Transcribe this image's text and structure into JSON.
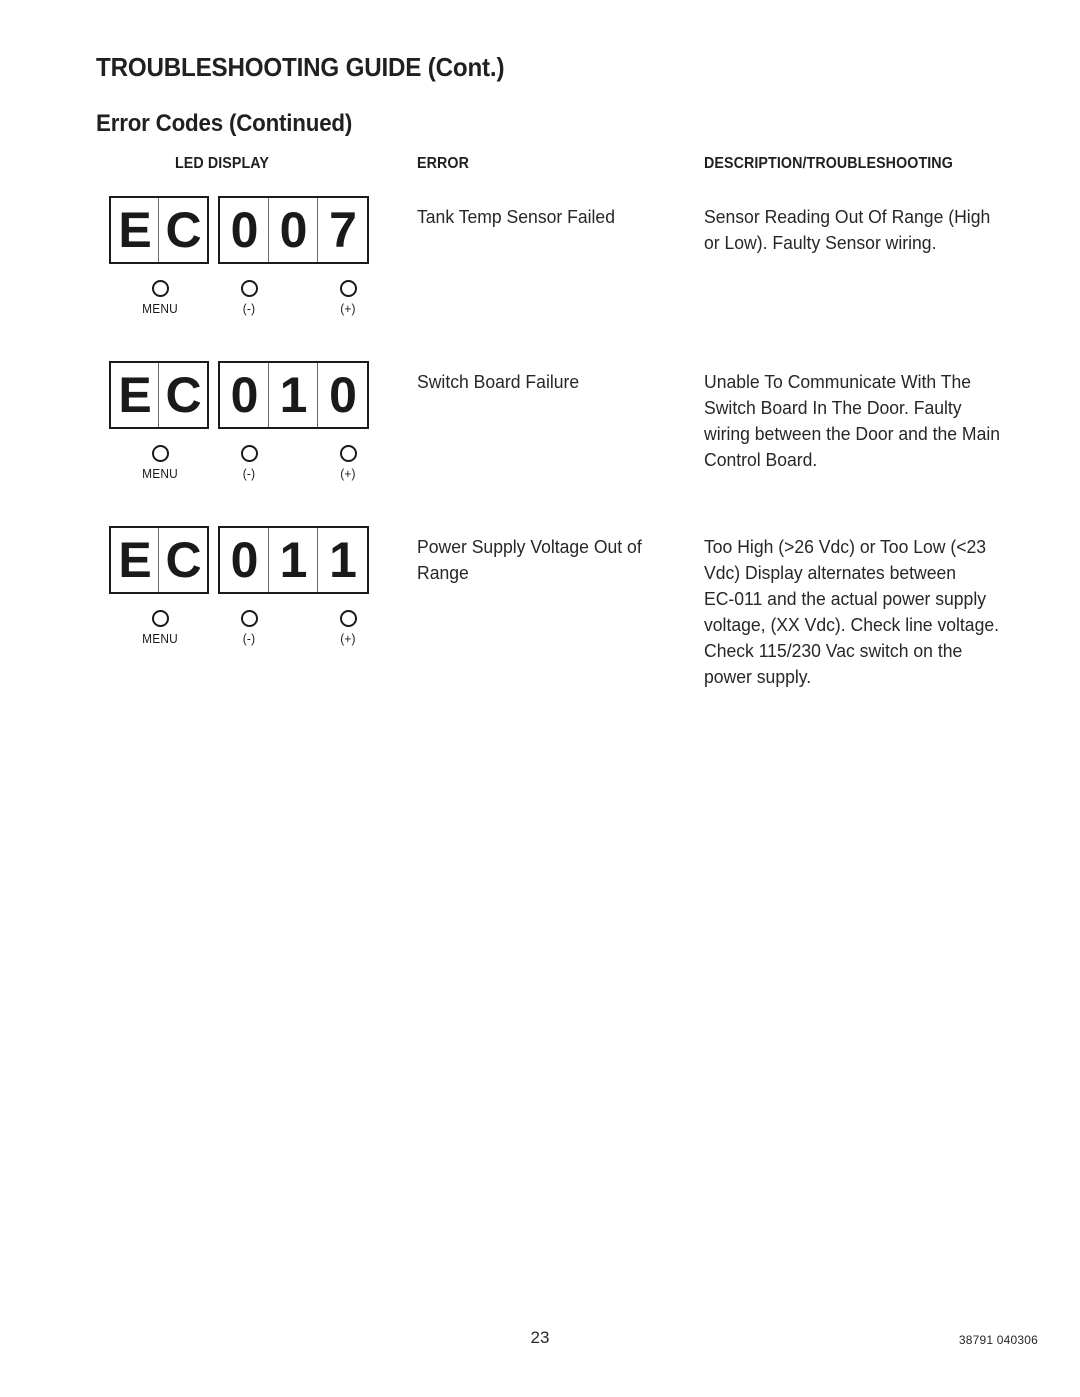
{
  "document": {
    "title": "TROUBLESHOOTING GUIDE (Cont.)",
    "subtitle": "Error Codes (Continued)",
    "page_number": "23",
    "doc_id": "38791 040306"
  },
  "table": {
    "headers": {
      "led_display": "LED DISPLAY",
      "error": "ERROR",
      "description": "DESCRIPTION/TROUBLESHOOTING"
    },
    "rows": [
      {
        "led": {
          "prefix_cells": [
            "E",
            "C"
          ],
          "digit_cells": [
            "0",
            "0",
            "7"
          ],
          "buttons": [
            {
              "label": "MENU",
              "icon": "circle-button-icon"
            },
            {
              "label": "(-)",
              "icon": "circle-button-icon"
            },
            {
              "label": "(+)",
              "icon": "circle-button-icon"
            }
          ]
        },
        "error": "Tank Temp Sensor Failed",
        "description_lines": [
          "Sensor Reading Out Of Range (High",
          "or Low). Faulty Sensor wiring."
        ]
      },
      {
        "led": {
          "prefix_cells": [
            "E",
            "C"
          ],
          "digit_cells": [
            "0",
            "1",
            "0"
          ],
          "buttons": [
            {
              "label": "MENU",
              "icon": "circle-button-icon"
            },
            {
              "label": "(-)",
              "icon": "circle-button-icon"
            },
            {
              "label": "(+)",
              "icon": "circle-button-icon"
            }
          ]
        },
        "error": "Switch Board Failure",
        "description_lines": [
          "Unable To Communicate With The",
          "Switch Board In The Door. Faulty",
          "wiring between the Door and the Main",
          "Control Board."
        ]
      },
      {
        "led": {
          "prefix_cells": [
            "E",
            "C"
          ],
          "digit_cells": [
            "0",
            "1",
            "1"
          ],
          "buttons": [
            {
              "label": "MENU",
              "icon": "circle-button-icon"
            },
            {
              "label": "(-)",
              "icon": "circle-button-icon"
            },
            {
              "label": "(+)",
              "icon": "circle-button-icon"
            }
          ]
        },
        "error": "Power Supply Voltage Out of Range",
        "description_lines": [
          "Too High (>26 Vdc) or Too Low (<23",
          "Vdc) Display alternates between",
          "EC-011 and the actual power supply",
          "voltage, (XX Vdc). Check line voltage.",
          "Check 115/230 Vac switch on the",
          "power supply."
        ]
      }
    ]
  },
  "colors": {
    "ink": "#231f20",
    "body_text": "#2b2526",
    "rule": "#1a1a1a"
  }
}
